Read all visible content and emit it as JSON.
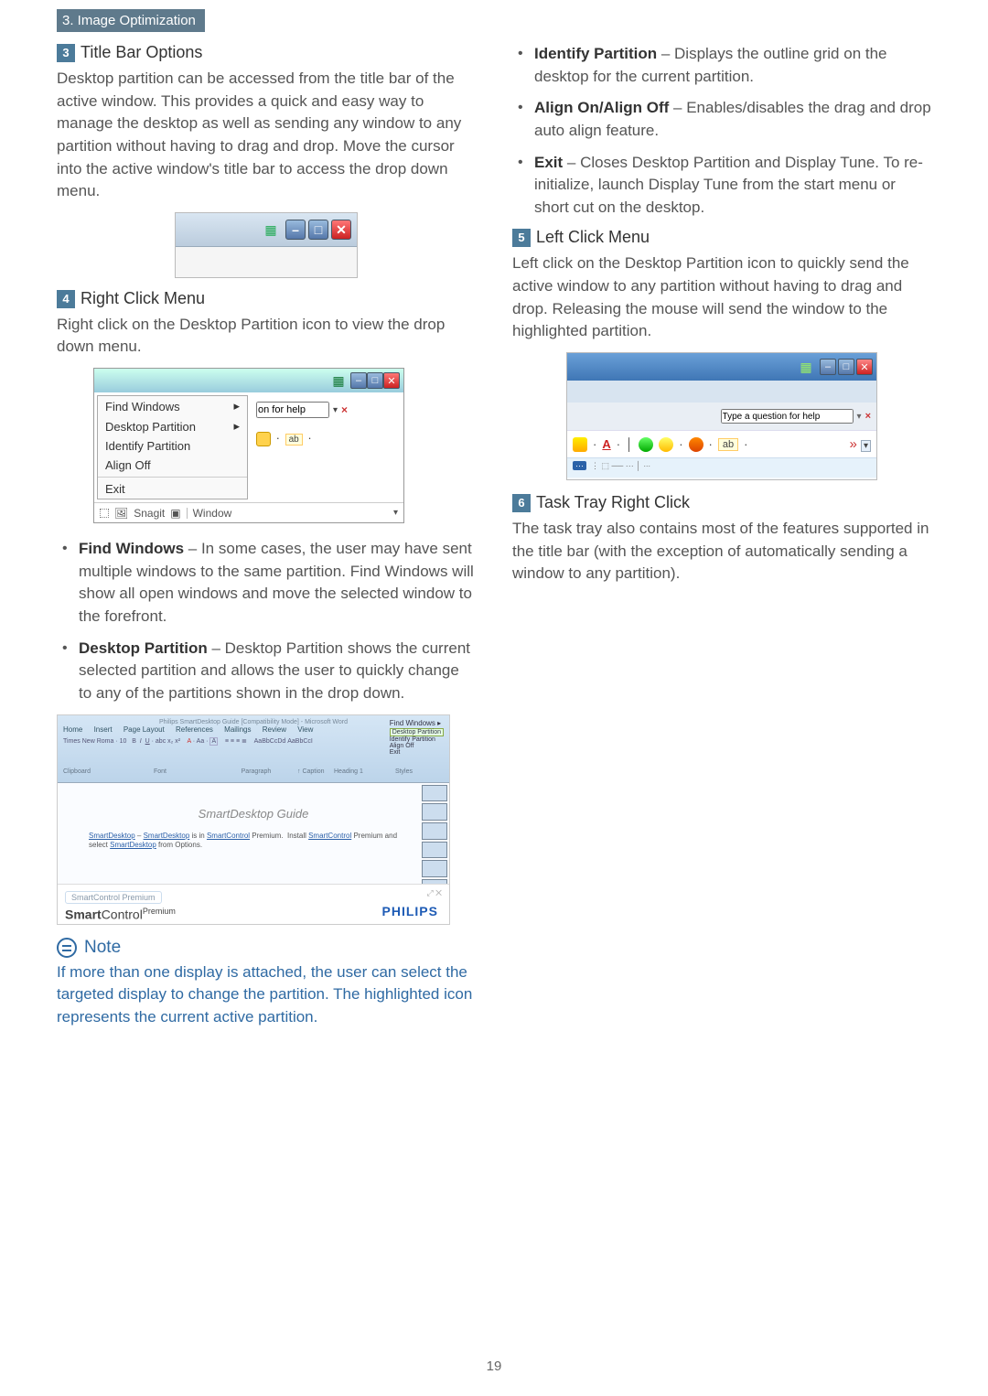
{
  "header_tab": "3. Image Optimization",
  "s3": {
    "num": "3",
    "title": "Title Bar Options",
    "body": "Desktop partition can be accessed from the title bar of the active window.  This provides a quick and easy way to manage the desktop as well as sending any window to any partition without having to drag and drop.  Move the cursor into the active window's title bar to access the drop down menu."
  },
  "s4": {
    "num": "4",
    "title": "Right Click Menu",
    "body": "Right click on the Desktop Partition icon to view the drop down menu.",
    "menu": {
      "find_windows": "Find Windows",
      "desktop_partition": "Desktop Partition",
      "identify_partition": "Identify Partition",
      "align_off": "Align Off",
      "exit": "Exit",
      "snagit": "Snagit",
      "window": "Window",
      "help_placeholder": "on for help"
    },
    "bullets": [
      {
        "lead": "Find Windows",
        "rest": " – In some cases, the user may have sent multiple windows to the same partition.  Find Windows will show all open windows and move the selected window to the forefront."
      },
      {
        "lead": "Desktop Partition",
        "rest": " – Desktop Partition shows the current selected partition and allows the user to quickly change to any of the partitions shown in the drop down."
      }
    ]
  },
  "fig3": {
    "tabs": [
      "Home",
      "Insert",
      "Page Layout",
      "References",
      "Mailings",
      "Review",
      "View"
    ],
    "title_text": "Philips SmartDesktop Guide [Compatibility Mode] - Microsoft Word",
    "doc_title": "SmartDesktop Guide",
    "doc_line": "SmartDesktop – SmartDesktop is in SmartControl Premium.  Install SmartControl Premium and select SmartDesktop from Options.",
    "links": [
      "SmartDesktop",
      "SmartDesktop",
      "SmartControl",
      "SmartControl"
    ],
    "sc_premium": "SmartControl Premium",
    "smartcontrol": "SmartControl",
    "premium_sup": "Premium",
    "philips": "PHILIPS",
    "find_windows": "Find Windows",
    "side_labels": [
      "Desktop Partition",
      "Identify Partition",
      "Align Off",
      "Exit"
    ],
    "ribbon_groups": [
      "Clipboard",
      "Font",
      "Paragraph",
      "Styles"
    ],
    "font_sample": "Times New Roma · 10",
    "styles": [
      "AaBbCcDd",
      "AaBbCcI",
      "↑ Caption",
      "Heading 1"
    ]
  },
  "note": {
    "head": "Note",
    "text": "If more than one display is attached, the user can select the targeted display to change the partition.  The highlighted icon represents the current active partition."
  },
  "right_bullets": [
    {
      "lead": "Identify Partition",
      "rest": " – Displays the outline grid on the desktop for the current partition."
    },
    {
      "lead": "Align On/Align Off",
      "rest": " – Enables/disables the drag and drop auto align feature."
    },
    {
      "lead": "Exit",
      "rest": " – Closes Desktop Partition and Display Tune.  To re-initialize, launch Display Tune from the start menu or short cut on the desktop."
    }
  ],
  "s5": {
    "num": "5",
    "title": "Left Click Menu",
    "body": "Left click on the Desktop Partition icon to quickly send the active window to any partition without having to drag and drop. Releasing the mouse will send the window to the highlighted partition.",
    "help_placeholder": "Type a question for help",
    "ab_label": "ab"
  },
  "s6": {
    "num": "6",
    "title": "Task Tray Right Click",
    "body": "The task tray also contains most of the features supported in the title bar (with the exception of automatically sending a window to any partition)."
  },
  "page_number": "19"
}
